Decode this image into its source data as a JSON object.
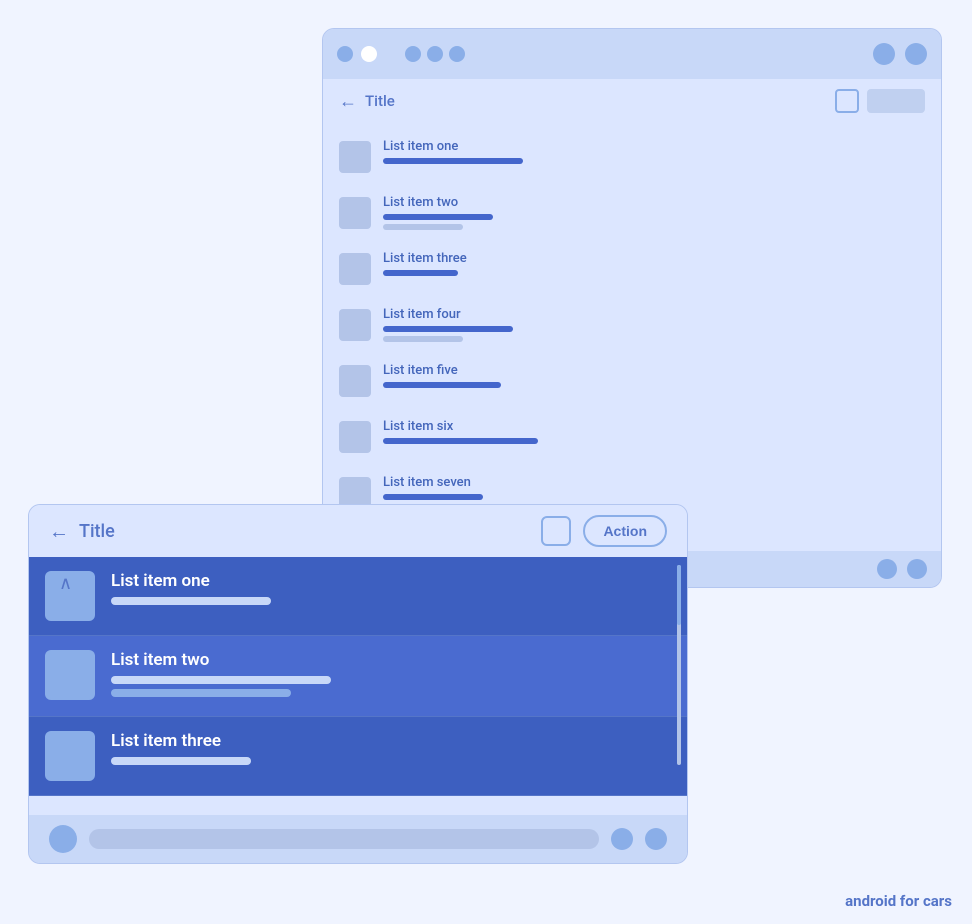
{
  "backWindow": {
    "titleBar": {
      "dots": [
        "dot1",
        "dot2-white",
        "dot3",
        "dot4",
        "dot5"
      ],
      "rightDots": [
        "right-dot1",
        "right-dot2"
      ]
    },
    "appBar": {
      "backLabel": "←",
      "title": "Title",
      "iconLabel": "",
      "btnLabel": ""
    },
    "listItems": [
      {
        "title": "List item one",
        "bar1Width": "140px",
        "showBar2": false,
        "bar2Width": "0px"
      },
      {
        "title": "List item two",
        "bar1Width": "110px",
        "showBar2": true,
        "bar2Width": "80px"
      },
      {
        "title": "List item three",
        "bar1Width": "75px",
        "showBar2": false,
        "bar2Width": "0px"
      },
      {
        "title": "List item four",
        "bar1Width": "130px",
        "showBar2": true,
        "bar2Width": "80px"
      },
      {
        "title": "List item five",
        "bar1Width": "118px",
        "showBar2": false,
        "bar2Width": "0px"
      },
      {
        "title": "List item six",
        "bar1Width": "155px",
        "showBar2": false,
        "bar2Width": "0px"
      },
      {
        "title": "List item seven",
        "bar1Width": "100px",
        "showBar2": false,
        "bar2Width": "0px"
      }
    ]
  },
  "frontWindow": {
    "appBar": {
      "backLabel": "←",
      "title": "Title",
      "actionLabel": "Action"
    },
    "listItems": [
      {
        "title": "List item one",
        "bar1Width": "160px",
        "showBar2": false
      },
      {
        "title": "List item two",
        "bar1Width": "220px",
        "showBar2": true,
        "bar2Width": "180px"
      },
      {
        "title": "List item three",
        "bar1Width": "140px",
        "showBar2": false
      }
    ]
  },
  "footer": {
    "label": "android for cars"
  }
}
